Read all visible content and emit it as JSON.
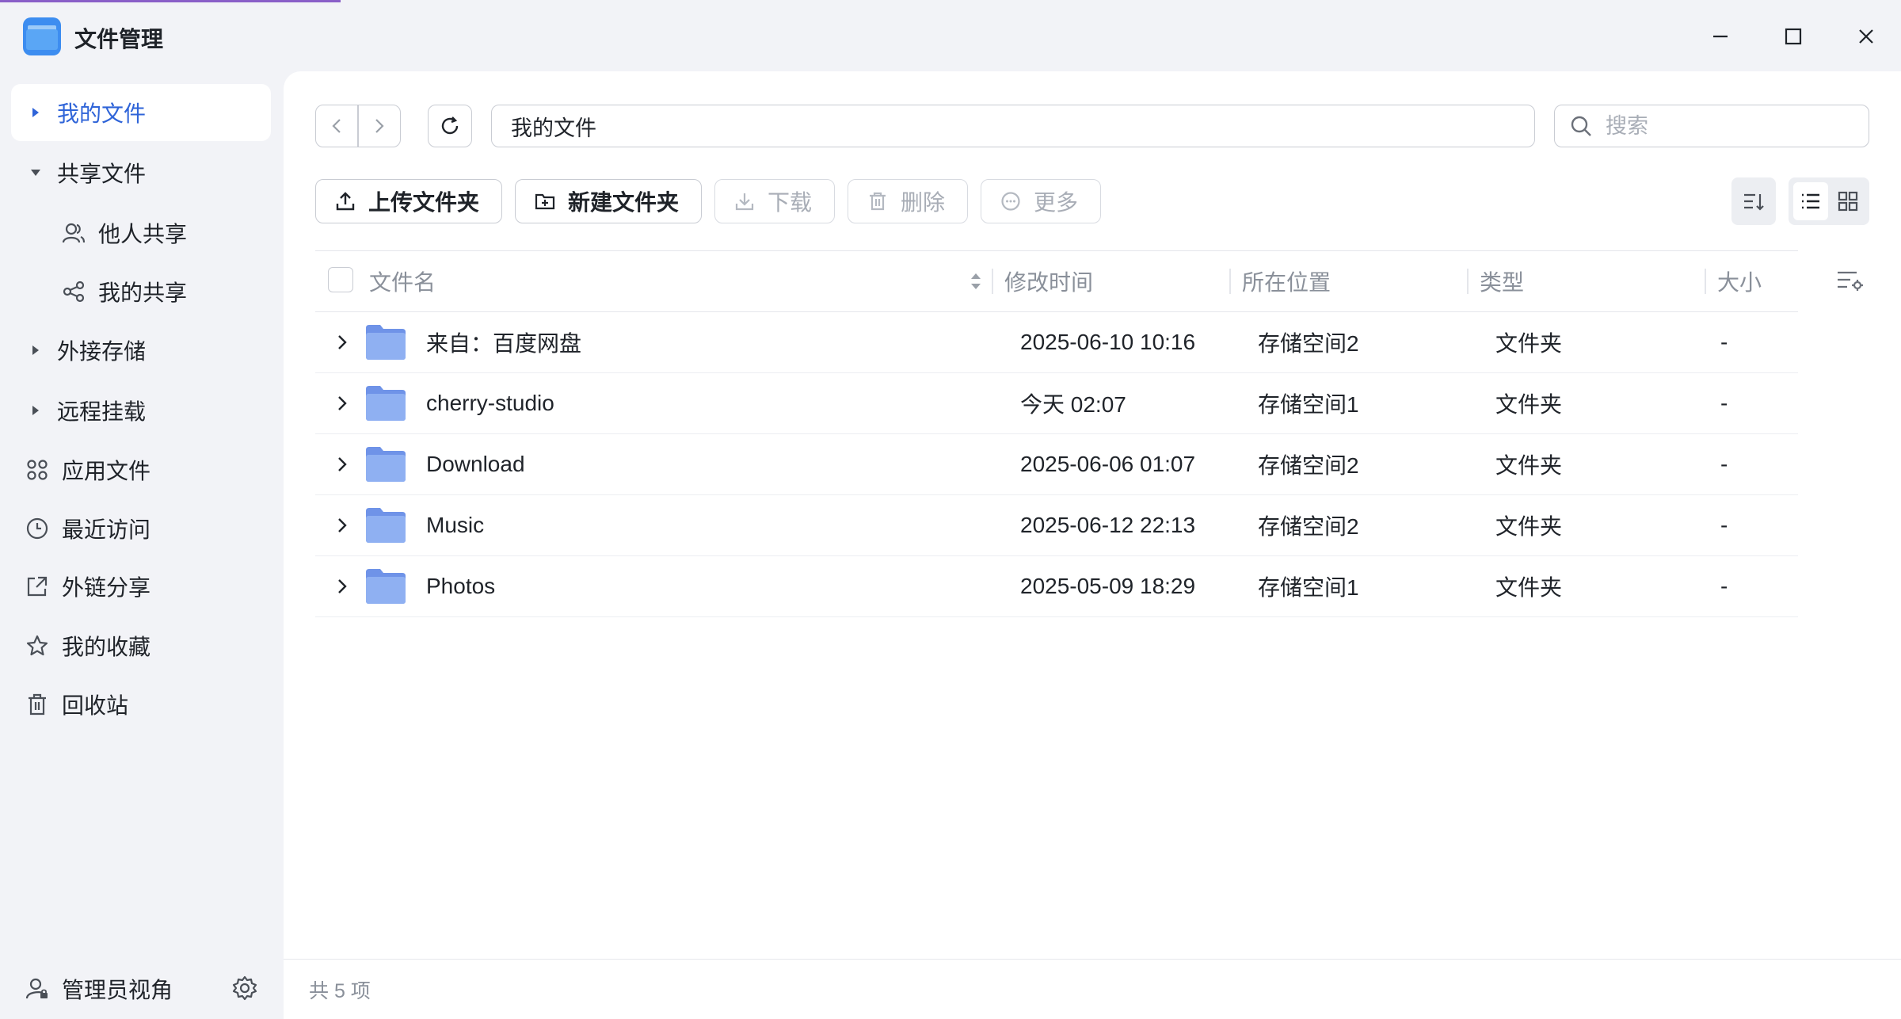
{
  "app": {
    "title": "文件管理"
  },
  "colors": {
    "accent": "#2f64d8",
    "folder": "#7ea2ee",
    "sidebar_bg": "#f2f3f7"
  },
  "sidebar": {
    "items": [
      {
        "label": "我的文件",
        "icon": "caret-right-icon",
        "active": true
      },
      {
        "label": "共享文件",
        "icon": "caret-down-icon"
      },
      {
        "label": "他人共享",
        "icon": "users-icon",
        "sub": true
      },
      {
        "label": "我的共享",
        "icon": "share-icon",
        "sub": true
      },
      {
        "label": "外接存储",
        "icon": "caret-right-icon"
      },
      {
        "label": "远程挂载",
        "icon": "caret-right-icon"
      },
      {
        "label": "应用文件",
        "icon": "apps-icon"
      },
      {
        "label": "最近访问",
        "icon": "clock-icon"
      },
      {
        "label": "外链分享",
        "icon": "external-share-icon"
      },
      {
        "label": "我的收藏",
        "icon": "star-icon"
      },
      {
        "label": "回收站",
        "icon": "trash-icon"
      }
    ],
    "footer": {
      "label": "管理员视角",
      "icon": "admin-user-icon",
      "settings_icon": "gear-icon"
    }
  },
  "toolbar": {
    "path": "我的文件",
    "search_placeholder": "搜索",
    "upload_label": "上传文件夹",
    "new_folder_label": "新建文件夹",
    "download_label": "下载",
    "delete_label": "删除",
    "more_label": "更多"
  },
  "table": {
    "columns": [
      "文件名",
      "修改时间",
      "所在位置",
      "类型",
      "大小"
    ],
    "rows": [
      {
        "name": "来自：百度网盘",
        "modified": "2025-06-10 10:16",
        "location": "存储空间2",
        "type": "文件夹",
        "size": "-"
      },
      {
        "name": "cherry-studio",
        "modified": "今天 02:07",
        "location": "存储空间1",
        "type": "文件夹",
        "size": "-"
      },
      {
        "name": "Download",
        "modified": "2025-06-06 01:07",
        "location": "存储空间2",
        "type": "文件夹",
        "size": "-"
      },
      {
        "name": "Music",
        "modified": "2025-06-12 22:13",
        "location": "存储空间2",
        "type": "文件夹",
        "size": "-"
      },
      {
        "name": "Photos",
        "modified": "2025-05-09 18:29",
        "location": "存储空间1",
        "type": "文件夹",
        "size": "-"
      }
    ]
  },
  "status": {
    "count_text": "共 5 项"
  }
}
